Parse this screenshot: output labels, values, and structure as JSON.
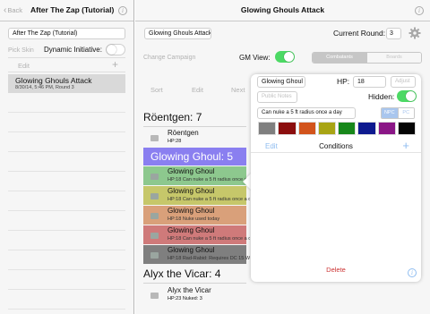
{
  "left": {
    "back_label": "Back",
    "title": "After The Zap (Tutorial)",
    "campaign_name": "After The Zap (Tutorial)",
    "pick_skin": "Pick Skin",
    "dynamic_initiative_label": "Dynamic Initiative:",
    "dynamic_initiative_on": false,
    "edit_label": "Edit",
    "encounters": [
      {
        "name": "Glowing Ghouls Attack",
        "subtitle": "8/30/14, 5:46 PM, Round 3"
      }
    ]
  },
  "right": {
    "title": "Glowing Ghouls Attack",
    "encounter_name": "Glowing Ghouls Attack",
    "current_round_label": "Current Round:",
    "current_round": "3",
    "change_campaign": "Change Campaign",
    "gm_view_label": "GM View:",
    "gm_view_on": true,
    "view_segments": [
      "Combatants",
      "Boards"
    ],
    "sort_label": "Sort",
    "edit_label": "Edit",
    "next_label": "Next",
    "groups": [
      {
        "header": "Röentgen: 7",
        "rows": [
          {
            "name": "Röentgen",
            "stats": "HP:28"
          }
        ]
      },
      {
        "header": "Glowing Ghoul: 5",
        "rows": [
          {
            "name": "Glowing Ghoul",
            "stats": "HP:18 Can nuke a 5 ft radius once a day",
            "color": "#8dc88e"
          },
          {
            "name": "Glowing Ghoul",
            "stats": "HP:18 Can nuke a 5 ft radius once a day",
            "color": "#c6c76a"
          },
          {
            "name": "Glowing Ghoul",
            "stats": "HP:18 Nuke used today",
            "color": "#d9a07a"
          },
          {
            "name": "Glowing Ghoul",
            "stats": "HP:18 Can nuke a 5 ft radius once a day",
            "color": "#cf7a7a"
          },
          {
            "name": "Glowing Ghoul",
            "stats": "HP:18 Rad-Rabid: Requires DC 15 Will save",
            "color": "#7f7f7f"
          }
        ]
      },
      {
        "header": "Alyx the Vicar: 4",
        "rows": [
          {
            "name": "Alyx the Vicar",
            "stats": "HP:23 Nuked: 3"
          }
        ]
      }
    ]
  },
  "popover": {
    "name": "Glowing Ghoul",
    "hp_label": "HP:",
    "hp": "18",
    "adjust_placeholder": "Adjust",
    "notes_placeholder": "Public Notes",
    "hidden_label": "Hidden:",
    "hidden_on": true,
    "description": "Can nuke a 5 ft radius once a day",
    "type_segments": [
      "NPC",
      "PC"
    ],
    "swatches": [
      "#7f7f7f",
      "#8b0e0e",
      "#d2541c",
      "#a8a414",
      "#17871a",
      "#0e1a8f",
      "#8a1686",
      "#050505"
    ],
    "edit_label": "Edit",
    "conditions_label": "Conditions",
    "delete_label": "Delete"
  },
  "colors": {
    "accent_green": "#4cd964",
    "selected_group": "#8a7ff0",
    "link_blue": "#8fbdf0",
    "delete_red": "#cc3333"
  }
}
